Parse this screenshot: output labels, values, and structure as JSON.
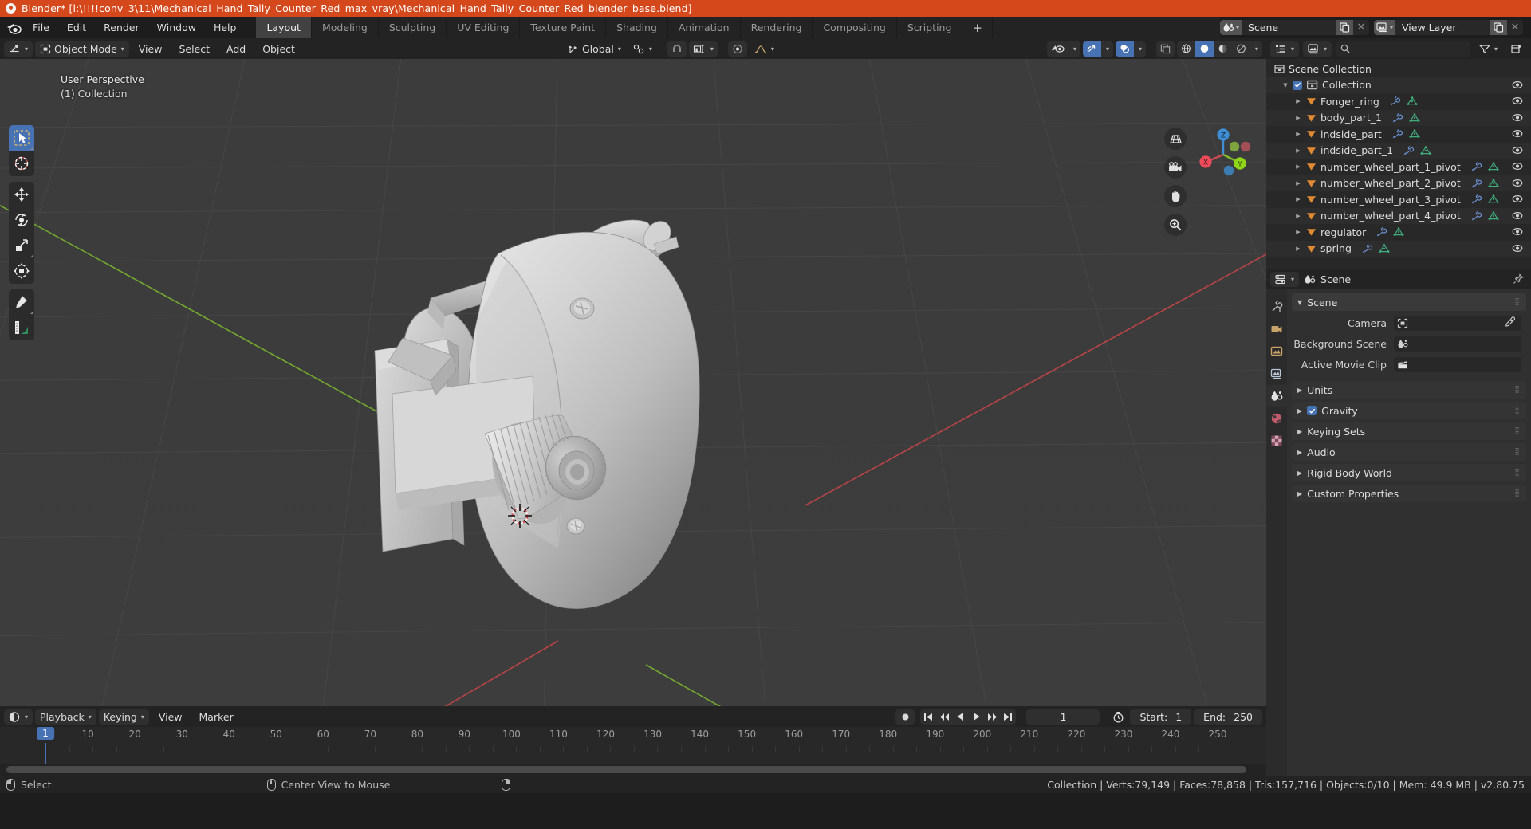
{
  "window": {
    "title": "Blender* [l:\\!!!!conv_3\\11\\Mechanical_Hand_Tally_Counter_Red_max_vray\\Mechanical_Hand_Tally_Counter_Red_blender_base.blend]",
    "accent_color": "#d4481b"
  },
  "topbar": {
    "menus": [
      "File",
      "Edit",
      "Render",
      "Window",
      "Help"
    ],
    "workspaces": [
      {
        "label": "Layout",
        "active": true
      },
      {
        "label": "Modeling",
        "active": false
      },
      {
        "label": "Sculpting",
        "active": false
      },
      {
        "label": "UV Editing",
        "active": false
      },
      {
        "label": "Texture Paint",
        "active": false
      },
      {
        "label": "Shading",
        "active": false
      },
      {
        "label": "Animation",
        "active": false
      },
      {
        "label": "Rendering",
        "active": false
      },
      {
        "label": "Compositing",
        "active": false
      },
      {
        "label": "Scripting",
        "active": false
      }
    ],
    "add_workspace_label": "+",
    "scene_name": "Scene",
    "view_layer_name": "View Layer"
  },
  "viewport_header": {
    "editor_type": "editor-type-3d-viewport",
    "mode": "Object Mode",
    "menus": [
      "View",
      "Select",
      "Add",
      "Object"
    ],
    "transform_orientation": "Global",
    "snap_enabled": false,
    "proportional_edit": false
  },
  "viewport": {
    "perspective_label": "User Perspective",
    "collection_label": "(1) Collection",
    "gizmo_axes": [
      "X",
      "Y",
      "Z"
    ],
    "tools": [
      "select-box-tool",
      "cursor-tool",
      "move-tool",
      "rotate-tool",
      "scale-tool",
      "transform-tool",
      "annotate-tool",
      "measure-tool"
    ],
    "nav_buttons": [
      "toggle-perspective-icon",
      "camera-view-icon",
      "pan-view-icon",
      "zoom-view-icon"
    ],
    "background_color": "#3d3d3d",
    "grid_color": "#4a4a4a",
    "axis_x_color": "#cf4648",
    "axis_y_color": "#7dbb2d",
    "object_color": "#c8c8c8"
  },
  "outliner": {
    "display_mode": "View Layer",
    "search_placeholder": "",
    "scene_collection_label": "Scene Collection",
    "collection_label": "Collection",
    "objects": [
      "Fonger_ring",
      "body_part_1",
      "indside_part",
      "indside_part_1",
      "number_wheel_part_1_pivot",
      "number_wheel_part_2_pivot",
      "number_wheel_part_3_pivot",
      "number_wheel_part_4_pivot",
      "regulator",
      "spring"
    ]
  },
  "properties": {
    "breadcrumb": "Scene",
    "panel_title": "Scene",
    "fields": [
      {
        "label": "Camera",
        "value": "",
        "icon": "camera-icon"
      },
      {
        "label": "Background Scene",
        "value": "",
        "icon": "scene-icon"
      },
      {
        "label": "Active Movie Clip",
        "value": "",
        "icon": "clip-icon"
      }
    ],
    "sections": [
      {
        "label": "Units",
        "checkbox": false,
        "checked": false
      },
      {
        "label": "Gravity",
        "checkbox": true,
        "checked": true
      },
      {
        "label": "Keying Sets",
        "checkbox": false,
        "checked": false
      },
      {
        "label": "Audio",
        "checkbox": false,
        "checked": false
      },
      {
        "label": "Rigid Body World",
        "checkbox": false,
        "checked": false
      },
      {
        "label": "Custom Properties",
        "checkbox": false,
        "checked": false
      }
    ],
    "tabs": [
      "tool-tab",
      "render-tab",
      "output-tab",
      "view-layer-tab",
      "scene-tab",
      "world-tab",
      "texture-tab"
    ]
  },
  "timeline": {
    "menus": [
      "Playback",
      "Keying",
      "View",
      "Marker"
    ],
    "current_frame": "1",
    "start_label": "Start:",
    "start_value": "1",
    "end_label": "End:",
    "end_value": "250",
    "ticks": [
      10,
      20,
      30,
      40,
      50,
      60,
      70,
      80,
      90,
      100,
      110,
      120,
      130,
      140,
      150,
      160,
      170,
      180,
      190,
      200,
      210,
      220,
      230,
      240,
      250
    ],
    "playhead_label": "1"
  },
  "statusbar": {
    "left_hint": "Select",
    "middle_hint": "Center View to Mouse",
    "stats": "Collection | Verts:79,149 | Faces:78,858 | Tris:157,716 | Objects:0/10 | Mem: 49.9 MB | v2.80.75"
  }
}
